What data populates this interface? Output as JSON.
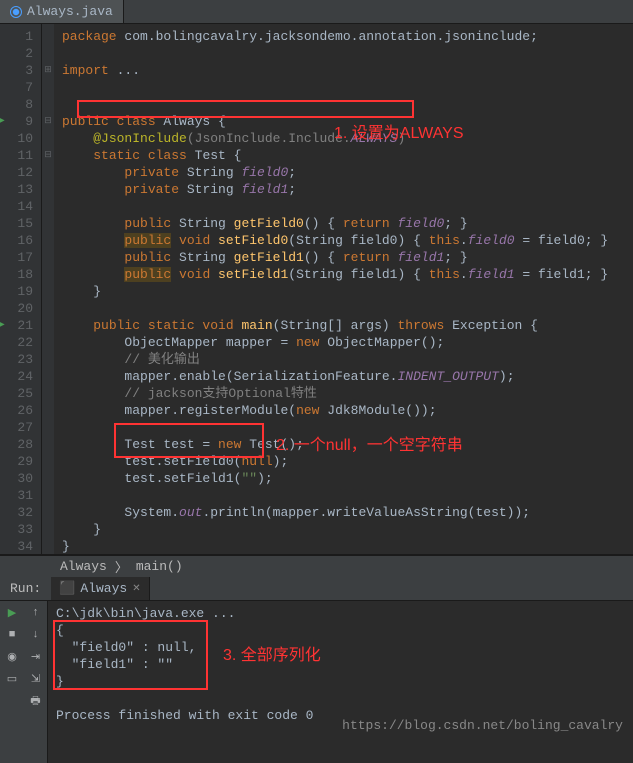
{
  "tab": {
    "filename": "Always.java"
  },
  "lines": [
    "1",
    "2",
    "3",
    "7",
    "8",
    "9",
    "10",
    "11",
    "12",
    "13",
    "14",
    "15",
    "16",
    "17",
    "18",
    "19",
    "20",
    "21",
    "22",
    "23",
    "24",
    "25",
    "26",
    "27",
    "28",
    "29",
    "30",
    "31",
    "32",
    "33",
    "34"
  ],
  "code": {
    "l1_kw": "package ",
    "l1_rest": "com.bolingcavalry.jacksondemo.annotation.jsoninclude;",
    "l3_kw": "import ",
    "l3_rest": "...",
    "l9a": "public class ",
    "l9b": "Always {",
    "l10a": "@JsonInclude",
    "l10b": "(JsonInclude.Include.",
    "l10c": "ALWAYS",
    "l10d": ")",
    "l11a": "static class ",
    "l11b": "Test {",
    "l12a": "private ",
    "l12b": "String ",
    "l12c": "field0",
    "l12d": ";",
    "l13a": "private ",
    "l13b": "String ",
    "l13c": "field1",
    "l13d": ";",
    "l15a": "public ",
    "l15b": "String ",
    "l15c": "getField0",
    "l15d": "() { ",
    "l15e": "return ",
    "l15f": "field0",
    "l15g": "; }",
    "l16a": "public",
    "l16b": " void ",
    "l16c": "setField0",
    "l16d": "(String field0) { ",
    "l16e": "this",
    "l16f": ".",
    "l16g": "field0",
    "l16h": " = field0; }",
    "l17a": "public ",
    "l17b": "String ",
    "l17c": "getField1",
    "l17d": "() { ",
    "l17e": "return ",
    "l17f": "field1",
    "l17g": "; }",
    "l18a": "public",
    "l18b": " void ",
    "l18c": "setField1",
    "l18d": "(String field1) { ",
    "l18e": "this",
    "l18f": ".",
    "l18g": "field1",
    "l18h": " = field1; }",
    "l19": "}",
    "l21a": "public static void ",
    "l21b": "main",
    "l21c": "(String[] args) ",
    "l21d": "throws ",
    "l21e": "Exception {",
    "l22a": "ObjectMapper mapper = ",
    "l22b": "new ",
    "l22c": "ObjectMapper();",
    "l23": "// 美化输出",
    "l24a": "mapper.enable(SerializationFeature.",
    "l24b": "INDENT_OUTPUT",
    "l24c": ");",
    "l25": "// jackson支持Optional特性",
    "l26a": "mapper.registerModule(",
    "l26b": "new ",
    "l26c": "Jdk8Module());",
    "l28a": "Test test = ",
    "l28b": "new ",
    "l28c": "Test();",
    "l29a": "test.setField0(",
    "l29b": "null",
    "l29c": ");",
    "l30a": "test.setField1(",
    "l30b": "\"\"",
    "l30c": ");",
    "l32a": "System.",
    "l32b": "out",
    "l32c": ".println(mapper.writeValueAsString(test));",
    "l33": "}",
    "l34": "}"
  },
  "breadcrumb": {
    "item1": "Always",
    "sep": "〉",
    "item2": "main()"
  },
  "run": {
    "label": "Run:",
    "tab": "Always",
    "out1": "C:\\jdk\\bin\\java.exe ...",
    "out2": "{",
    "out3": "  \"field0\" : null,",
    "out4": "  \"field1\" : \"\"",
    "out5": "}",
    "out6": "Process finished with exit code 0"
  },
  "annotations": {
    "a1": "1. 设置为ALWAYS",
    "a2": "2. 一个null，一个空字符串",
    "a3": "3. 全部序列化"
  },
  "watermark": "https://blog.csdn.net/boling_cavalry"
}
